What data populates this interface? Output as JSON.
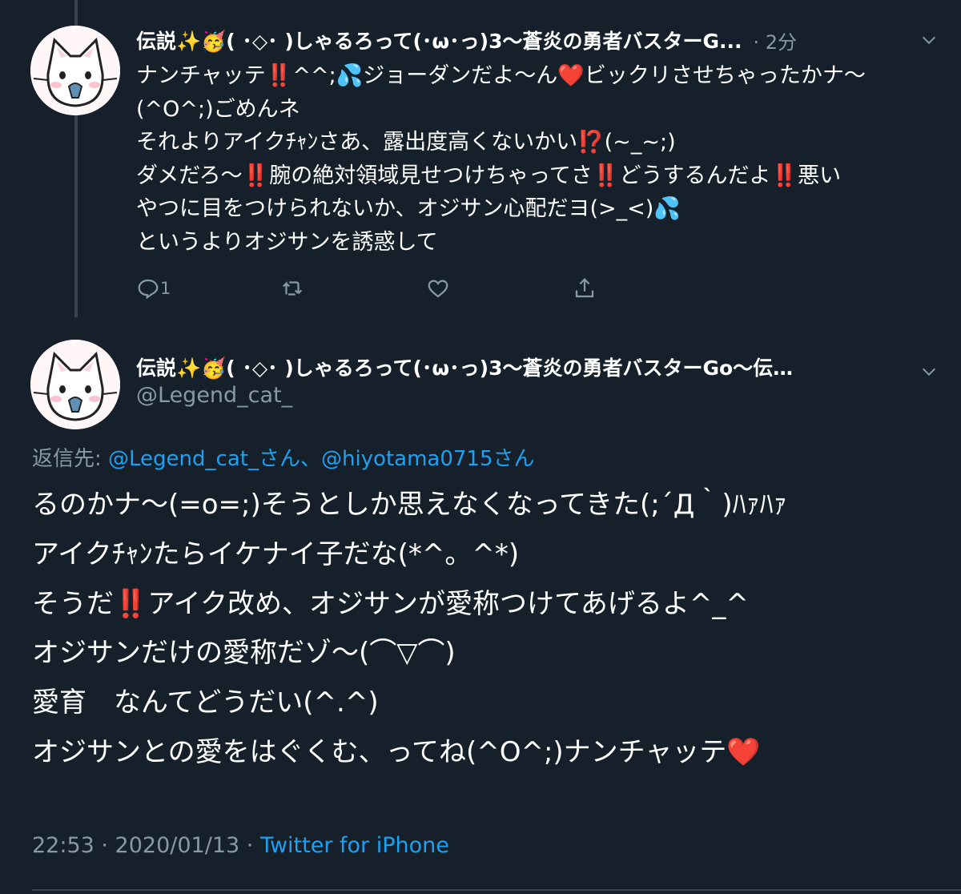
{
  "tweet1": {
    "name": "伝説✨🥳( ･◇･ )しゃるろって(･ω･っ)3〜蒼炎の勇者バスターG...",
    "time": "· 2分",
    "lines": [
      "ナンチャッテ‼️^^;💦ジョーダンだよ〜ん❤️ビックリさせちゃったかナ〜",
      "(^O^;)ごめんネ",
      "それよりアイクﾁｬﾝさあ、露出度高くないかい⁉️(~_~;)",
      "ダメだろ〜‼️腕の絶対領域見せつけちゃってさ‼️どうするんだよ‼️悪い",
      "やつに目をつけられないか、オジサン心配だヨ(>_<)💦",
      "というよりオジサンを誘惑して"
    ],
    "reply_count": "1"
  },
  "tweet2": {
    "name": "伝説✨🥳( ･◇･ )しゃるろって(･ω･っ)3〜蒼炎の勇者バスターGo〜伝…",
    "handle": "@Legend_cat_",
    "replying_label": "返信先:",
    "replying_to": "@Legend_cat_さん、@hiyotama0715さん",
    "lines": [
      "るのかナ〜(=o=;)そうとしか思えなくなってきた(;´Д｀)ﾊｧﾊｧ",
      "アイクﾁｬﾝたらイケナイ子だな(*^。^*)",
      "そうだ‼️アイク改め、オジサンが愛称つけてあげるよ^_^",
      "オジサンだけの愛称だゾ〜(⌒▽⌒)",
      "愛育　なんてどうだい(^.^)",
      "オジサンとの愛をはぐくむ、ってね(^O^;)ナンチャッテ❤️"
    ],
    "timestamp": "22:53 · 2020/01/13 · ",
    "source": "Twitter for iPhone"
  },
  "colors": {
    "background": "#15202b",
    "text": "#ffffff",
    "secondary": "#8899a6",
    "link": "#1da1f2",
    "divider": "#38444d"
  },
  "icons": [
    "cat-avatar",
    "chevron-down-icon",
    "reply-icon",
    "retweet-icon",
    "like-icon",
    "share-icon"
  ]
}
